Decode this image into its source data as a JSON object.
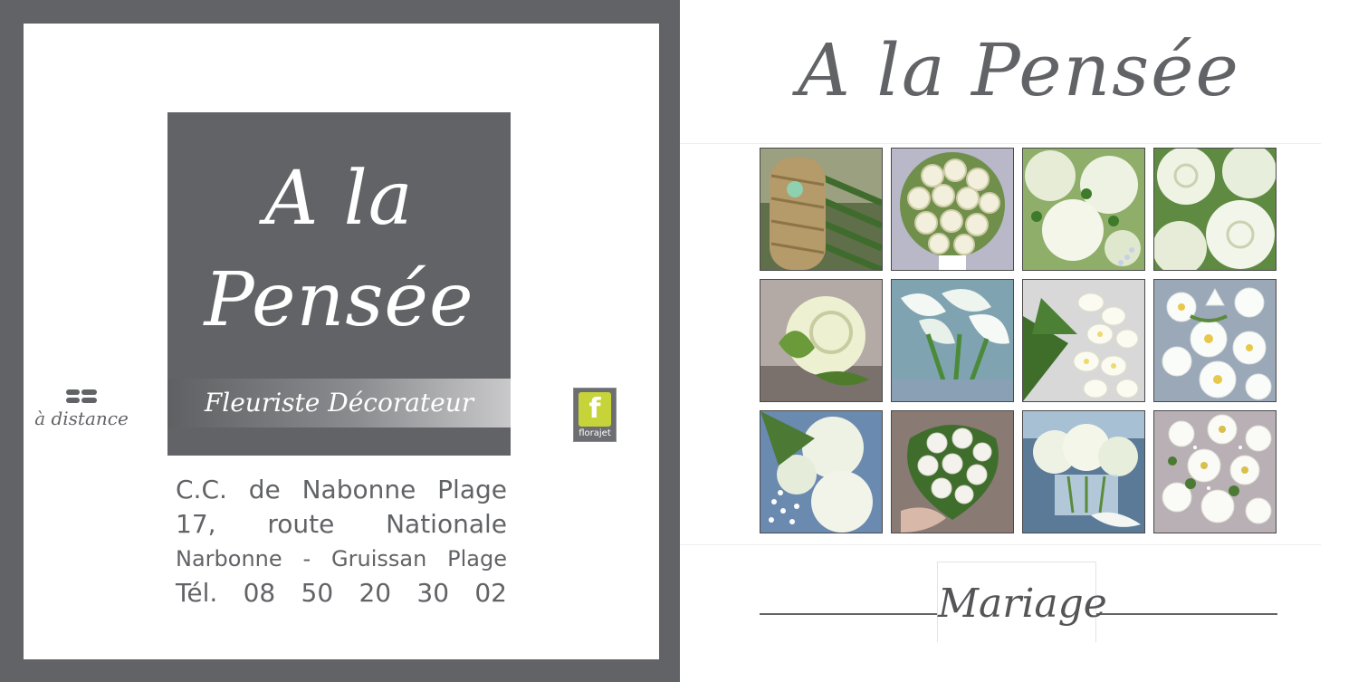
{
  "card_left": {
    "logo_title_line1": "A la",
    "logo_title_line2": "Pensée",
    "logo_tagline": "Fleuriste Décorateur",
    "distance_label": "à distance",
    "florajet_icon_letter": "f",
    "florajet_label": "florajet",
    "address": {
      "line1": "C.C. de Nabonne Plage",
      "line2": "17, route Nationale",
      "line3": "Narbonne - Gruissan Plage",
      "phone": "Tél. 08 50 20 30 02"
    }
  },
  "card_right": {
    "title": "A la Pensée",
    "section_label": "Mariage",
    "photos": [
      {
        "subject": "bound-stems-bouquet"
      },
      {
        "subject": "round-rose-bouquet"
      },
      {
        "subject": "roses-closeup"
      },
      {
        "subject": "white-roses"
      },
      {
        "subject": "single-rose"
      },
      {
        "subject": "calla-lilies"
      },
      {
        "subject": "freesia-bouquet"
      },
      {
        "subject": "orchid-bouquet"
      },
      {
        "subject": "roses-gypsophila"
      },
      {
        "subject": "hand-held-bouquet"
      },
      {
        "subject": "table-centerpiece"
      },
      {
        "subject": "orchid-arrangement"
      }
    ]
  },
  "colors": {
    "brand_gray": "#626366",
    "florajet_green": "#c6d43a",
    "white": "#ffffff"
  }
}
